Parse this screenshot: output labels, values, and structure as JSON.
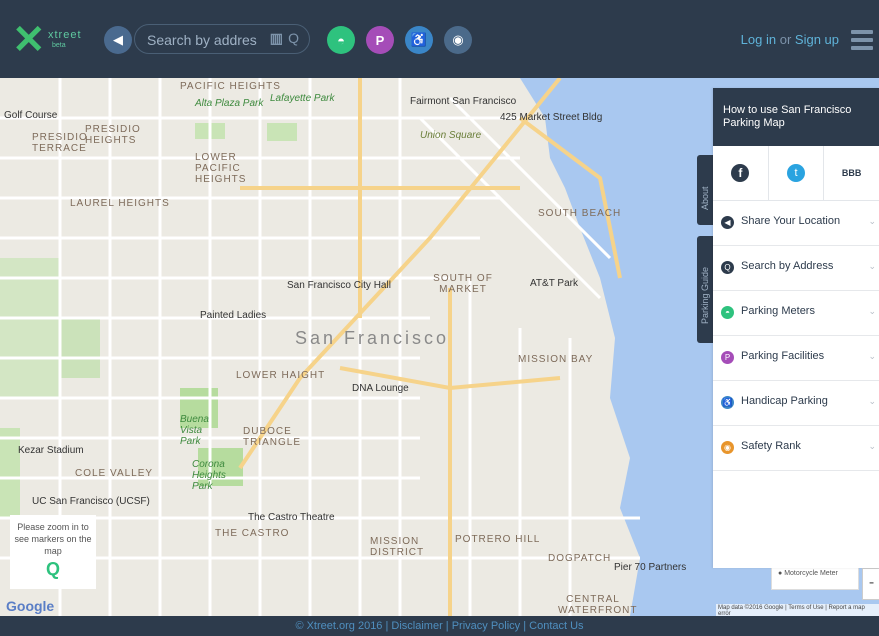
{
  "header": {
    "logo_text": "xtreet",
    "logo_sub": "beta",
    "search_placeholder": "Search by address",
    "login": "Log in",
    "or": "or",
    "signup": "Sign up",
    "nav_icons": [
      "location-arrow-icon",
      "parking-meter-icon",
      "parking-facility-icon",
      "handicap-icon",
      "safety-shield-icon"
    ],
    "colors": {
      "bar": "#2d3b4c",
      "meter": "#2ec27e",
      "parking": "#a54db8",
      "handicap": "#3a86c8",
      "safety": "#4b6a8a"
    }
  },
  "map": {
    "big_label": "San Francisco",
    "districts": [
      "PACIFIC HEIGHTS",
      "PRESIDIO HEIGHTS",
      "PRESIDIO TERRACE",
      "LOWER PACIFIC HEIGHTS",
      "LAUREL HEIGHTS",
      "SOUTH OF MARKET",
      "SOUTH BEACH",
      "MISSION BAY",
      "LOWER HAIGHT",
      "DUBOCE TRIANGLE",
      "COLE VALLEY",
      "THE CASTRO",
      "MISSION DISTRICT",
      "POTRERO HILL",
      "DOGPATCH",
      "CENTRAL WATERFRONT"
    ],
    "pois": [
      "Fairmont San Francisco",
      "425 Market Street Bldg",
      "Union Square",
      "San Francisco City Hall",
      "AT&T Park",
      "Painted Ladies",
      "DNA Lounge",
      "Kezar Stadium",
      "UC San Francisco (UCSF)",
      "The Castro Theatre",
      "Pier 70 Partners",
      "Golf Course"
    ],
    "parks": [
      "Alta Plaza Park",
      "Lafayette Park",
      "Buena Vista Park",
      "Corona Heights Park"
    ],
    "zoom_hint": "Please zoom in to see markers on the map",
    "google": "Google",
    "attribution": "Map data ©2016 Google | Terms of Use | Report a map error",
    "legend_item": "Motorcycle Meter",
    "zoom_minus": "-"
  },
  "side_tabs": {
    "about": "About",
    "guide": "Parking Guide"
  },
  "panel": {
    "title": "How to use San Francisco Parking Map",
    "social": [
      "facebook-icon",
      "twitter-icon",
      "bbb-icon"
    ],
    "items": [
      {
        "label": "Share Your Location",
        "icon": "location-arrow-icon",
        "color": "#2d3b4c",
        "glyph": "◀"
      },
      {
        "label": "Search by Address",
        "icon": "search-icon",
        "color": "#2d3b4c",
        "glyph": "Q"
      },
      {
        "label": "Parking Meters",
        "icon": "parking-meter-icon",
        "color": "#2ec27e",
        "glyph": "◓"
      },
      {
        "label": "Parking Facilities",
        "icon": "parking-facility-icon",
        "color": "#a54db8",
        "glyph": "P"
      },
      {
        "label": "Handicap Parking",
        "icon": "handicap-icon",
        "color": "#3a86c8",
        "glyph": "♿"
      },
      {
        "label": "Safety Rank",
        "icon": "safety-shield-icon",
        "color": "#e8952c",
        "glyph": "◉"
      }
    ]
  },
  "footer": "© Xtreet.org 2016 | Disclaimer | Privacy Policy | Contact Us"
}
